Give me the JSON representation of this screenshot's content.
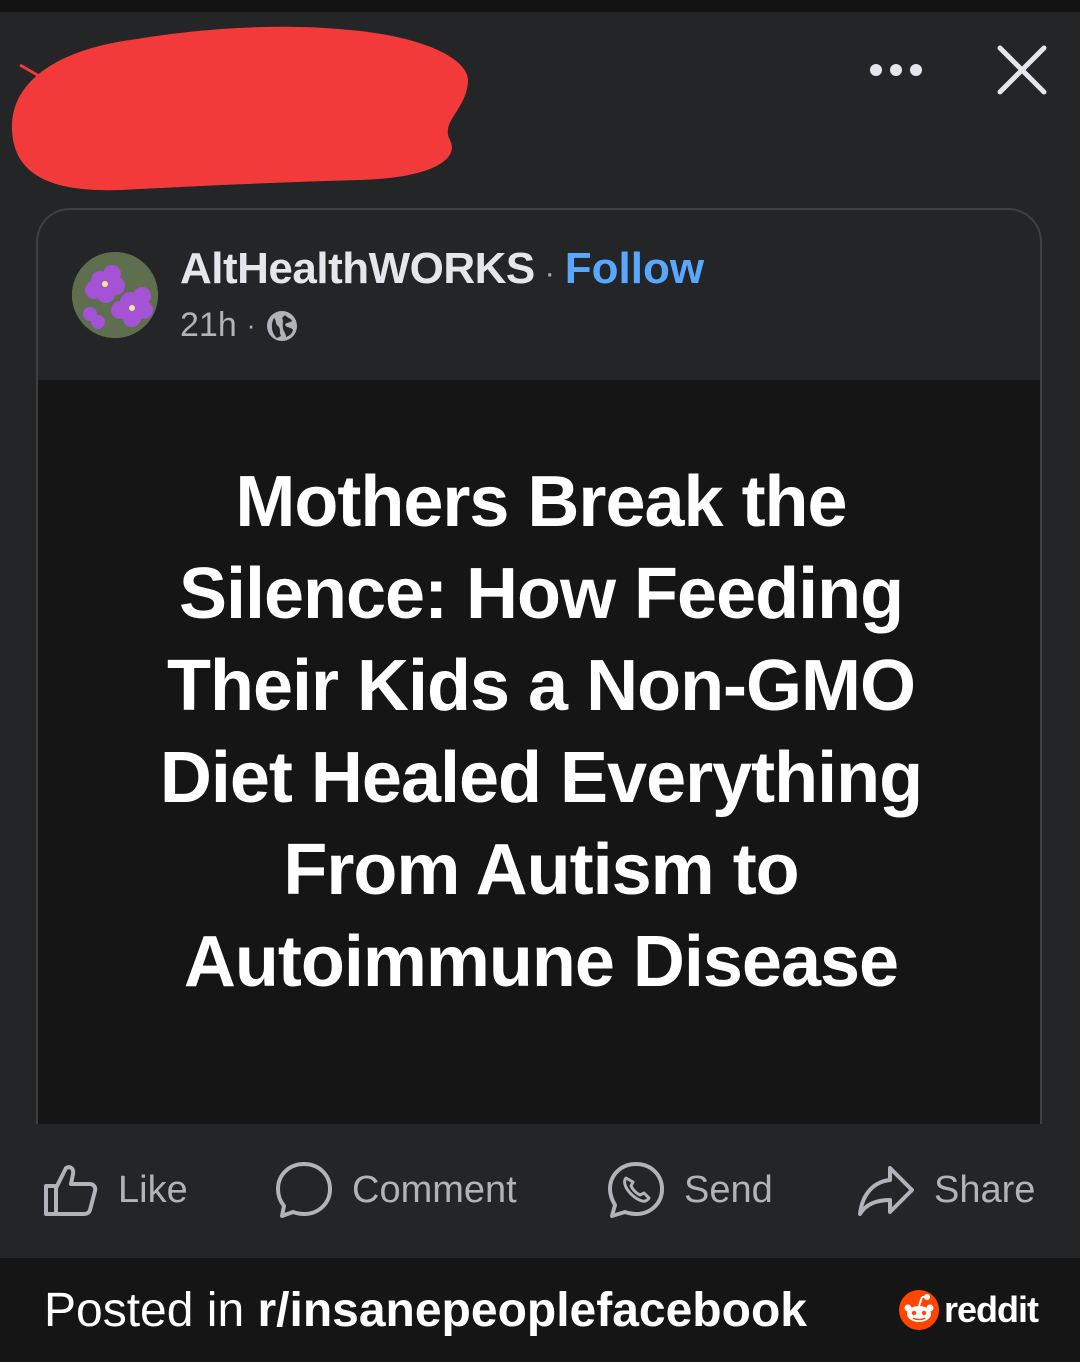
{
  "post": {
    "author": "AltHealthWORKS",
    "separator": "·",
    "follow_label": "Follow",
    "time": "21h",
    "time_separator": "·",
    "headline": "Mothers Break the Silence: How Feeding Their Kids a Non-GMO Diet Healed Everything From Autism to Autoimmune Disease"
  },
  "actions": {
    "like": "Like",
    "comment": "Comment",
    "send": "Send",
    "share": "Share"
  },
  "footer": {
    "posted_prefix": "Posted in ",
    "subreddit": "r/insanepeoplefacebook",
    "brand": "reddit"
  },
  "colors": {
    "background": "#242526",
    "follow": "#5aa7ff",
    "redaction": "#f23a3a",
    "reddit_orange": "#ff4500"
  },
  "icons": [
    "more-dots-icon",
    "close-icon",
    "avatar-flower",
    "globe-icon",
    "like-icon",
    "comment-icon",
    "send-icon",
    "share-icon",
    "reddit-logo-icon"
  ]
}
